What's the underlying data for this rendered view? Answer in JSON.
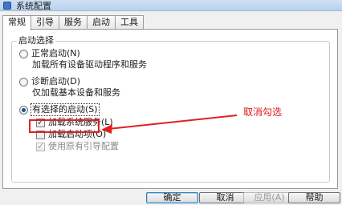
{
  "window": {
    "title": "系统配置"
  },
  "tabs": [
    {
      "label": "常规",
      "active": true
    },
    {
      "label": "引导",
      "active": false
    },
    {
      "label": "服务",
      "active": false
    },
    {
      "label": "启动",
      "active": false
    },
    {
      "label": "工具",
      "active": false
    }
  ],
  "startup_selection": {
    "legend": "启动选择",
    "normal": {
      "label": "正常启动(N)",
      "description": "加载所有设备驱动程序和服务",
      "selected": false
    },
    "diagnostic": {
      "label": "诊断启动(D)",
      "description": "仅加载基本设备和服务",
      "selected": false
    },
    "selective": {
      "label": "有选择的启动(S)",
      "selected": true,
      "options": [
        {
          "label": "加载系统服务(L)",
          "checked": true,
          "enabled": true
        },
        {
          "label": "加载启动项(O)",
          "checked": false,
          "enabled": true
        },
        {
          "label": "使用原有引导配置",
          "checked": true,
          "enabled": false
        }
      ]
    }
  },
  "annotation": {
    "text": "取消勾选",
    "color": "#e01818"
  },
  "buttons": {
    "ok": "确定",
    "cancel": "取消",
    "apply": "应用(A)",
    "help": "帮助"
  }
}
